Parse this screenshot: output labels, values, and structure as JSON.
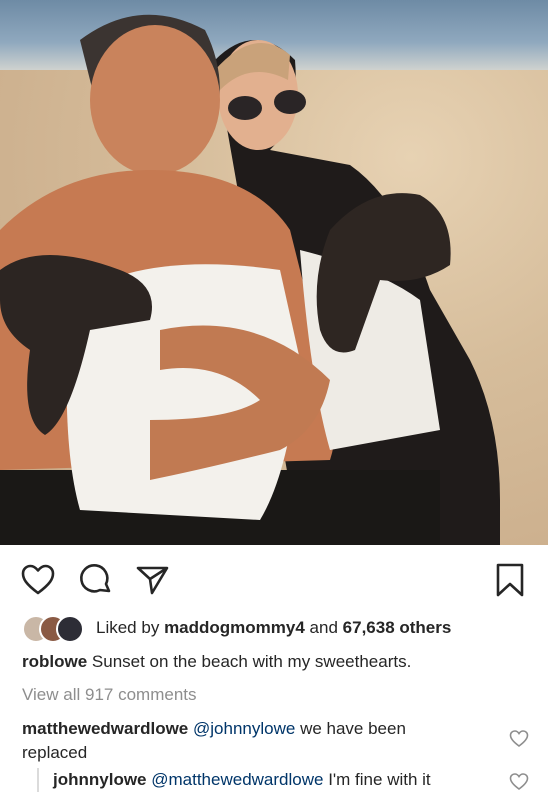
{
  "post": {
    "photo_icon": "beach-photo",
    "actions": {
      "like_icon": "heart-icon",
      "comment_icon": "comment-icon",
      "share_icon": "share-icon",
      "save_icon": "bookmark-icon"
    },
    "likes": {
      "prefix": "Liked by",
      "liker": "maddogmommy4",
      "connector": "and",
      "others": "67,638 others"
    },
    "caption": {
      "username": "roblowe",
      "text": "Sunset on the beach with my sweethearts."
    },
    "view_all_comments": "View all 917 comments",
    "comments": [
      {
        "username": "matthewedwardlowe",
        "mention": "@johnnylowe",
        "text": "we have been replaced"
      },
      {
        "username": "johnnylowe",
        "mention": "@matthewedwardlowe",
        "text": "I'm fine with it"
      }
    ]
  },
  "colors": {
    "text": "#262626",
    "muted": "#8e8e8e",
    "mention": "#003569"
  }
}
